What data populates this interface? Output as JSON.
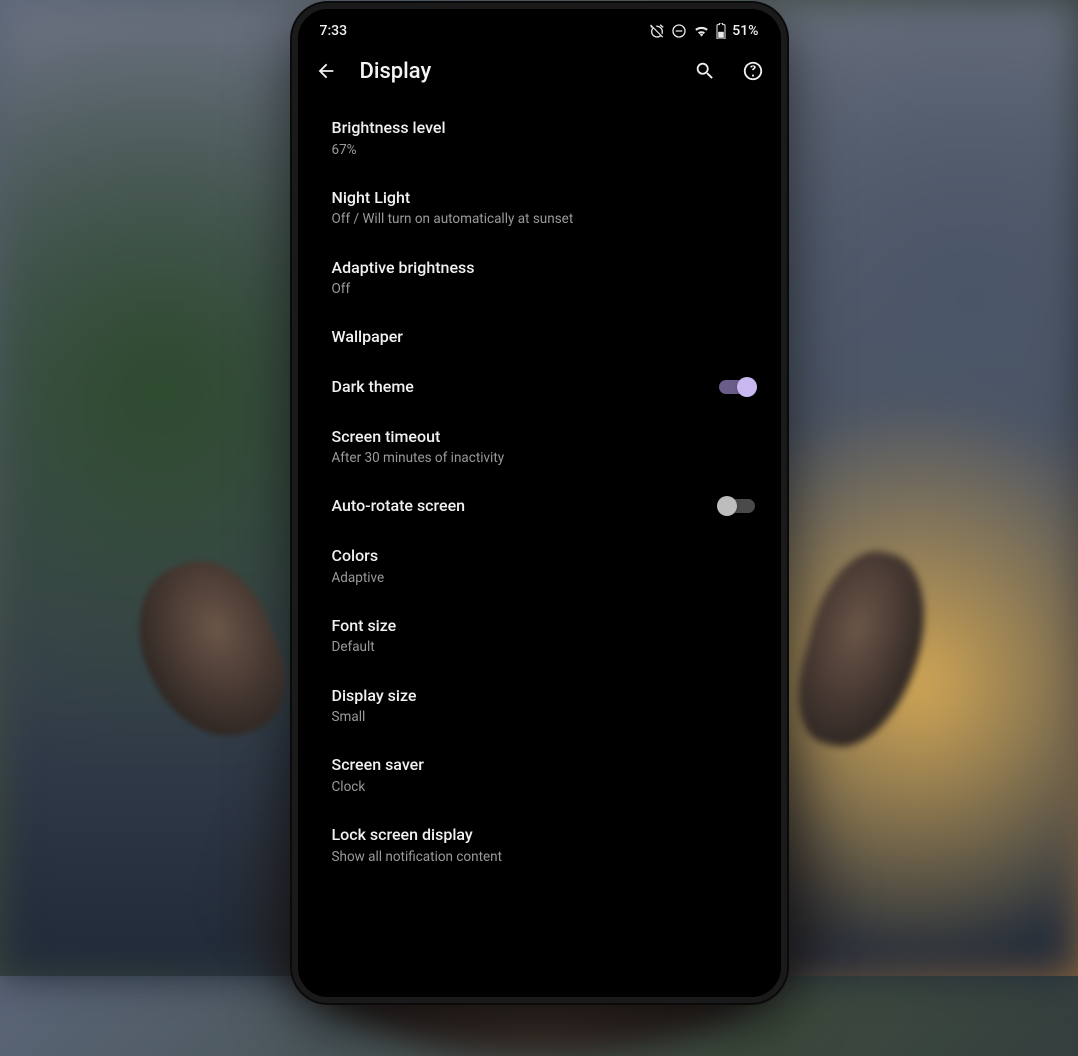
{
  "status": {
    "time": "7:33",
    "battery_text": "51%"
  },
  "header": {
    "title": "Display"
  },
  "settings": [
    {
      "title": "Brightness level",
      "sub": "67%",
      "toggle": null
    },
    {
      "title": "Night Light",
      "sub": "Off / Will turn on automatically at sunset",
      "toggle": null
    },
    {
      "title": "Adaptive brightness",
      "sub": "Off",
      "toggle": null
    },
    {
      "title": "Wallpaper",
      "sub": null,
      "toggle": null
    },
    {
      "title": "Dark theme",
      "sub": null,
      "toggle": true
    },
    {
      "title": "Screen timeout",
      "sub": "After 30 minutes of inactivity",
      "toggle": null
    },
    {
      "title": "Auto-rotate screen",
      "sub": null,
      "toggle": false
    },
    {
      "title": "Colors",
      "sub": "Adaptive",
      "toggle": null
    },
    {
      "title": "Font size",
      "sub": "Default",
      "toggle": null
    },
    {
      "title": "Display size",
      "sub": "Small",
      "toggle": null
    },
    {
      "title": "Screen saver",
      "sub": "Clock",
      "toggle": null
    },
    {
      "title": "Lock screen display",
      "sub": "Show all notification content",
      "toggle": null
    }
  ]
}
